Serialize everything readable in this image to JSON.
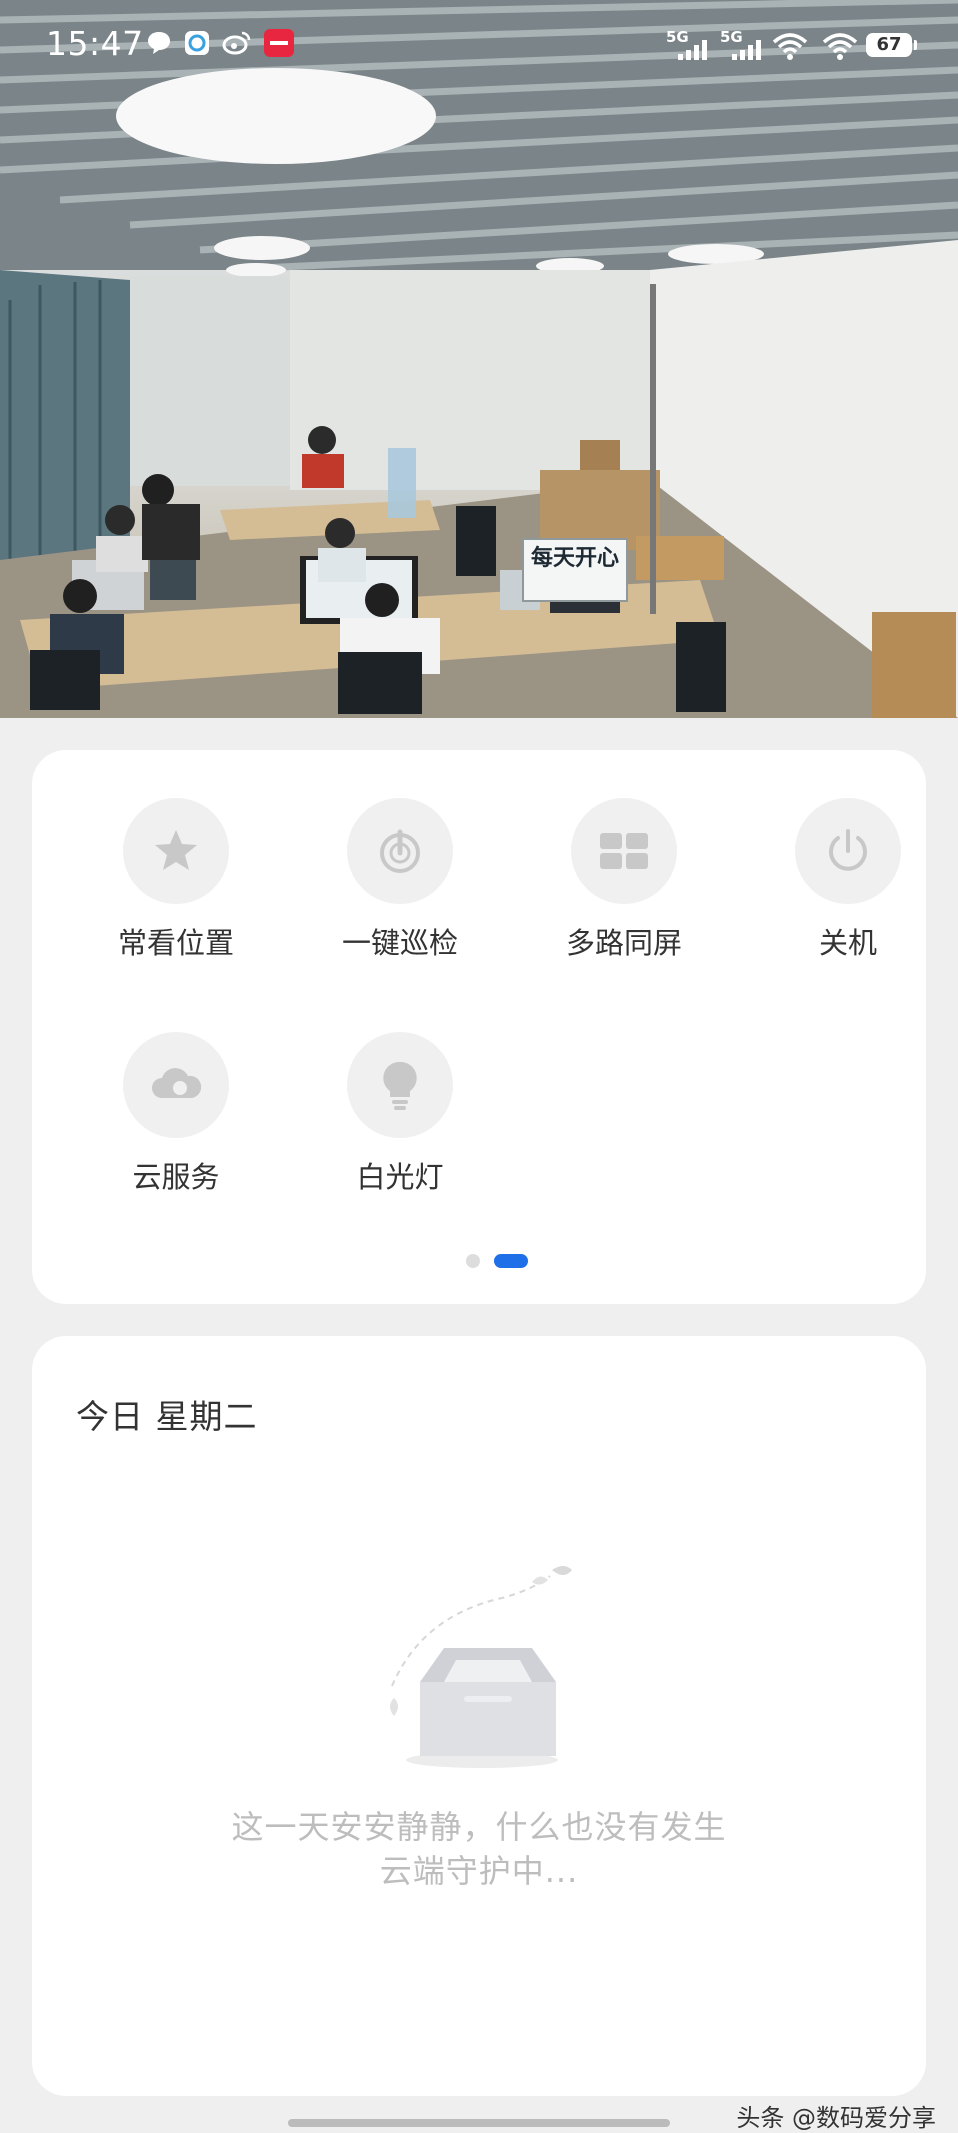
{
  "status_bar": {
    "time": "15:47",
    "notification_icons": [
      "chat-bubble-icon",
      "q-app-icon",
      "weibo-icon",
      "red-app-icon"
    ],
    "signal_1": "5G",
    "signal_2": "5G",
    "battery": "67"
  },
  "video": {
    "sign_text": "每天开心"
  },
  "actions": {
    "items": [
      {
        "label": "常看位置",
        "icon": "star-icon"
      },
      {
        "label": "一键巡检",
        "icon": "patrol-icon"
      },
      {
        "label": "多路同屏",
        "icon": "multi-screen-icon"
      },
      {
        "label": "关机",
        "icon": "power-icon"
      },
      {
        "label": "云服务",
        "icon": "cloud-icon"
      },
      {
        "label": "白光灯",
        "icon": "light-bulb-icon"
      }
    ],
    "page_indicator": {
      "total": 2,
      "active": 2
    }
  },
  "today": {
    "title": "今日 星期二",
    "empty_line_1": "这一天安安静静，什么也没有发生",
    "empty_line_2": "云端守护中..."
  },
  "footer": {
    "watermark": "头条 @数码爱分享"
  },
  "colors": {
    "accent": "#1e6fe8",
    "card": "#ffffff",
    "background": "#efefef",
    "icon_bg": "#f0f0f0",
    "icon_fg": "#c8c8c8"
  }
}
